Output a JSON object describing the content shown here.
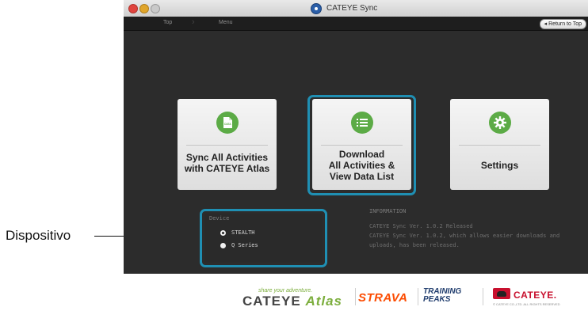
{
  "window": {
    "title": "CATEYE Sync",
    "nav": {
      "crumb_top": "Top",
      "crumb_menu": "Menu",
      "return_button": "◂ Return to Top"
    }
  },
  "tiles": [
    {
      "label": "Sync All Activities\nwith CATEYE Atlas",
      "icon": "data-file-icon"
    },
    {
      "label": "Download\nAll Activities &\nView Data List",
      "icon": "list-icon"
    },
    {
      "label": "Settings",
      "icon": "gear-icon"
    }
  ],
  "device": {
    "title": "Device",
    "options": [
      {
        "label": "STEALTH",
        "selected": true
      },
      {
        "label": "Q Series",
        "selected": false
      }
    ]
  },
  "information": {
    "title": "INFORMATION",
    "lines": [
      "CATEYE Sync Ver. 1.0.2 Released",
      "CATEYE Sync Ver. 1.0.2, which allows easier downloads and",
      "uploads, has been released."
    ]
  },
  "footer": {
    "atlas_tagline": "share your adventure.",
    "atlas_brand": "CATEYE",
    "atlas_word": "Atlas",
    "strava": "STRAVA",
    "training_peaks": "TRAINING\nPEAKS",
    "cateye": "CATEYE.",
    "copyright": "© CATEYE CO.,LTD. ALL RIGHTS RESERVED"
  },
  "callout": {
    "label": "Dispositivo"
  },
  "colors": {
    "accent_green": "#5cab46",
    "highlight_blue": "#1f8fb3",
    "window_bg": "#2c2c2c",
    "strava_orange": "#fc4c02",
    "cateye_red": "#c8102e"
  }
}
